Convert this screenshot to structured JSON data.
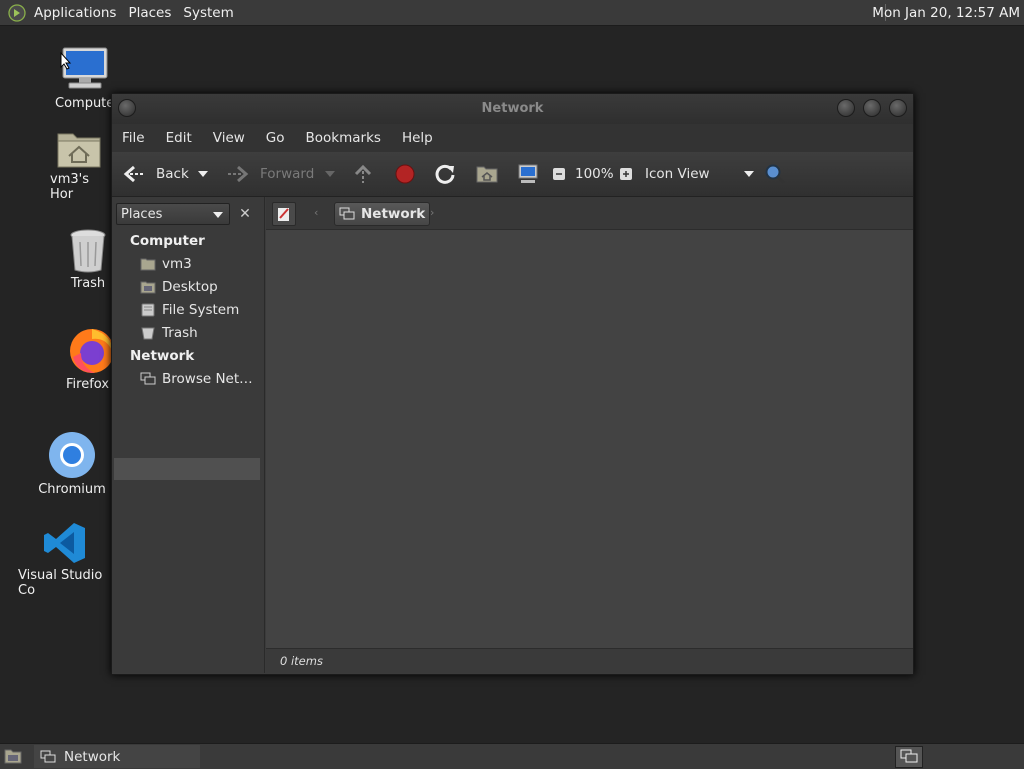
{
  "top_panel": {
    "menus": [
      "Applications",
      "Places",
      "System"
    ],
    "clock": "Mon Jan 20, 12:57 AM"
  },
  "desktop_icons": [
    {
      "label": "Compute"
    },
    {
      "label": "vm3's Hor"
    },
    {
      "label": "Trash"
    },
    {
      "label": "Firefox"
    },
    {
      "label": "Chromium"
    },
    {
      "label": "Visual Studio Co"
    }
  ],
  "window": {
    "title": "Network",
    "menu": [
      "File",
      "Edit",
      "View",
      "Go",
      "Bookmarks",
      "Help"
    ],
    "toolbar": {
      "back": "Back",
      "forward": "Forward",
      "zoom": "100%",
      "view_mode": "Icon View"
    },
    "sidebar": {
      "selector": "Places",
      "sections": [
        {
          "heading": "Computer",
          "items": [
            "vm3",
            "Desktop",
            "File System",
            "Trash"
          ]
        },
        {
          "heading": "Network",
          "items": [
            "Browse Net…"
          ]
        }
      ]
    },
    "location": {
      "current": "Network"
    },
    "status": "0 items"
  },
  "taskbar": {
    "items": [
      "Network"
    ]
  }
}
